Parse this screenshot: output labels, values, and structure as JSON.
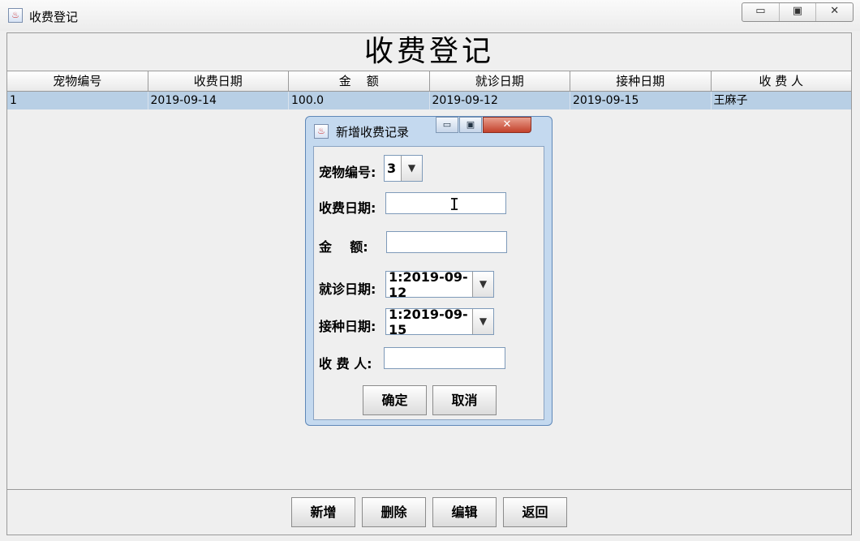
{
  "window": {
    "title": "收费登记",
    "controls": {
      "minimize": "▭",
      "maximize": "▣",
      "close": "✕"
    }
  },
  "heading": "收费登记",
  "table": {
    "columns": [
      "宠物编号",
      "收费日期",
      "金    额",
      "就诊日期",
      "接种日期",
      "收 费 人"
    ],
    "rows": [
      [
        "1",
        "2019-09-14",
        "100.0",
        "2019-09-12",
        "2019-09-15",
        "王麻子"
      ]
    ]
  },
  "buttons": {
    "add": "新增",
    "delete": "删除",
    "edit": "编辑",
    "back": "返回"
  },
  "dialog": {
    "title": "新增收费记录",
    "pet_id_label": "宠物编号:",
    "pet_id_value": "3",
    "fee_date_label": "收费日期:",
    "fee_date_value": "",
    "amount_label": "金    额:",
    "amount_value": "",
    "visit_date_label": "就诊日期:",
    "visit_date_value": "1:2019-09-12",
    "vaccine_date_label": "接种日期:",
    "vaccine_date_value": "1:2019-09-15",
    "collector_label": "收 费 人:",
    "collector_value": "",
    "confirm": "确定",
    "cancel": "取消"
  }
}
